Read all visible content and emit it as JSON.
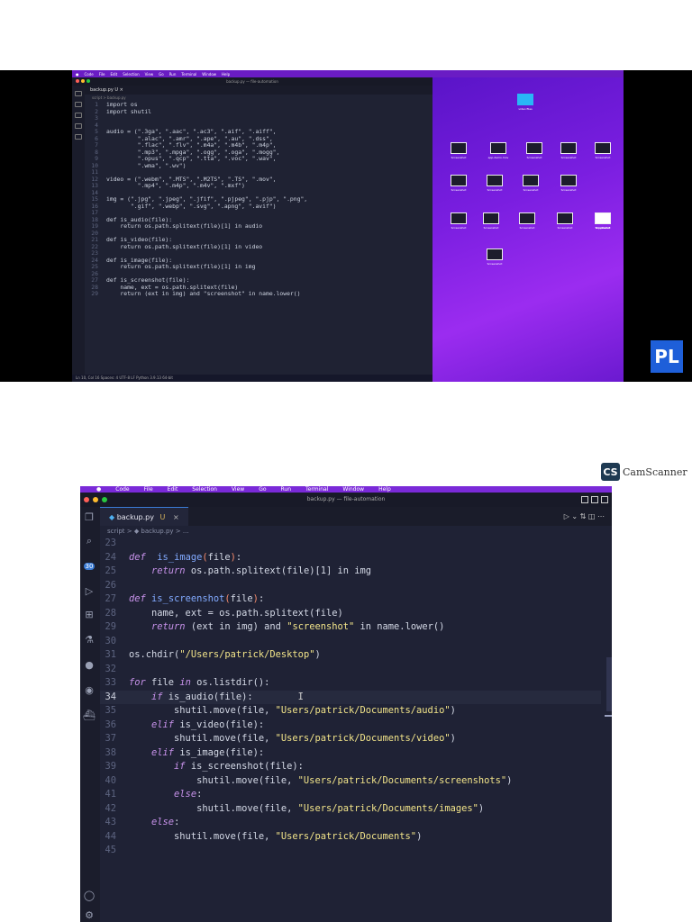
{
  "shot1": {
    "menubar": [
      "Code",
      "File",
      "Edit",
      "Selection",
      "View",
      "Go",
      "Run",
      "Terminal",
      "Window",
      "Help"
    ],
    "window_title": "backup.py — file-automation",
    "tab_label": "backup.py U ×",
    "breadcrumb": "script > backup.py",
    "code_lines": [
      {
        "n": "1",
        "t": "import os"
      },
      {
        "n": "2",
        "t": "import shutil"
      },
      {
        "n": "3",
        "t": ""
      },
      {
        "n": "4",
        "t": ""
      },
      {
        "n": "5",
        "t": "audio = (\".3ga\", \".aac\", \".ac3\", \".aif\", \".aiff\","
      },
      {
        "n": "6",
        "t": "         \".alac\", \".amr\", \".ape\", \".au\", \".dss\","
      },
      {
        "n": "7",
        "t": "         \".flac\", \".flv\", \".m4a\", \".m4b\", \".m4p\","
      },
      {
        "n": "8",
        "t": "         \".mp3\", \".mpga\", \".ogg\", \".oga\", \".mogg\","
      },
      {
        "n": "9",
        "t": "         \".opus\", \".qcp\", \".tta\", \".voc\", \".wav\","
      },
      {
        "n": "10",
        "t": "         \".wma\", \".wv\")"
      },
      {
        "n": "11",
        "t": ""
      },
      {
        "n": "12",
        "t": "video = (\".webm\", \".MTS\", \".M2TS\", \".TS\", \".mov\","
      },
      {
        "n": "13",
        "t": "         \".mp4\", \".m4p\", \".m4v\", \".mxf\")"
      },
      {
        "n": "14",
        "t": ""
      },
      {
        "n": "15",
        "t": "img = (\".jpg\", \".jpeg\", \".jfif\", \".pjpeg\", \".pjp\", \".png\","
      },
      {
        "n": "16",
        "t": "       \".gif\", \".webp\", \".svg\", \".apng\", \".avif\")"
      },
      {
        "n": "17",
        "t": ""
      },
      {
        "n": "18",
        "t": "def is_audio(file):"
      },
      {
        "n": "19",
        "t": "    return os.path.splitext(file)[1] in audio"
      },
      {
        "n": "20",
        "t": ""
      },
      {
        "n": "21",
        "t": "def is_video(file):"
      },
      {
        "n": "22",
        "t": "    return os.path.splitext(file)[1] in video"
      },
      {
        "n": "23",
        "t": ""
      },
      {
        "n": "24",
        "t": "def is_image(file):"
      },
      {
        "n": "25",
        "t": "    return os.path.splitext(file)[1] in img"
      },
      {
        "n": "26",
        "t": ""
      },
      {
        "n": "27",
        "t": "def is_screenshot(file):"
      },
      {
        "n": "28",
        "t": "    name, ext = os.path.splitext(file)"
      },
      {
        "n": "29",
        "t": "    return (ext in img) and \"screenshot\" in name.lower()"
      }
    ],
    "status_text": "Ln 10, Col 16   Spaces: 4   UTF-8   LF   Python   3.9.13 64-bit",
    "desktop_labels": [
      "video files",
      "Screenshot",
      "app-demo.mov",
      "Screenshot",
      "Screenshot",
      "Screenshot",
      "Screenshot",
      "Screenshot",
      "Screenshot",
      "Screenshot",
      "Screenshot",
      "Screenshot",
      "Screenshot",
      "Screenshot",
      "Screenshot",
      "Screenshot",
      "my_file.txt",
      "Screenshot"
    ],
    "logo_text": "PL"
  },
  "watermark": {
    "logo_text": "CS",
    "brand": "CamScanner"
  },
  "shot2": {
    "menubar": [
      "Code",
      "File",
      "Edit",
      "Selection",
      "View",
      "Go",
      "Run",
      "Terminal",
      "Window",
      "Help"
    ],
    "window_title": "backup.py — file-automation",
    "tab": {
      "name": "backup.py",
      "status": "U",
      "close": "×"
    },
    "tab_tools": "▷ ⌄  ⇅  ◫  ⋯",
    "breadcrumb": "script  >  ◆ backup.py  > ...",
    "activity_badge": "30",
    "lines": [
      {
        "n": "23",
        "parts": []
      },
      {
        "n": "24",
        "parts": [
          [
            "kw",
            "def"
          ],
          [
            "",
            "  "
          ],
          [
            "fn",
            "is_image"
          ],
          [
            "par",
            "("
          ],
          [
            "",
            "file"
          ],
          [
            "par",
            ")"
          ],
          [
            "",
            ":"
          ]
        ]
      },
      {
        "n": "25",
        "parts": [
          [
            "",
            "    "
          ],
          [
            "kw",
            "return"
          ],
          [
            "",
            " os.path.splitext(file)[1] in img"
          ]
        ]
      },
      {
        "n": "26",
        "parts": []
      },
      {
        "n": "27",
        "parts": [
          [
            "kw",
            "def"
          ],
          [
            "",
            " "
          ],
          [
            "fn",
            "is_screenshot"
          ],
          [
            "par",
            "("
          ],
          [
            "",
            "file"
          ],
          [
            "par",
            ")"
          ],
          [
            "",
            ":"
          ]
        ]
      },
      {
        "n": "28",
        "parts": [
          [
            "",
            "    name, ext = os.path.splitext(file)"
          ]
        ]
      },
      {
        "n": "29",
        "parts": [
          [
            "",
            "    "
          ],
          [
            "kw",
            "return"
          ],
          [
            "",
            " (ext in img) and "
          ],
          [
            "str",
            "\"screenshot\""
          ],
          [
            "",
            " in name.lower()"
          ]
        ]
      },
      {
        "n": "30",
        "parts": []
      },
      {
        "n": "31",
        "parts": [
          [
            "",
            "os.chdir("
          ],
          [
            "str",
            "\"/Users/patrick/Desktop\""
          ],
          [
            "",
            ")"
          ]
        ]
      },
      {
        "n": "32",
        "parts": []
      },
      {
        "n": "33",
        "parts": [
          [
            "kw",
            "for"
          ],
          [
            "",
            " file "
          ],
          [
            "kw",
            "in"
          ],
          [
            "",
            " os.listdir():"
          ]
        ]
      },
      {
        "n": "34",
        "cur": true,
        "parts": [
          [
            "",
            "    "
          ],
          [
            "kw",
            "if"
          ],
          [
            "",
            " is_audio(file):"
          ],
          [
            "cur-mark",
            "        I"
          ]
        ]
      },
      {
        "n": "35",
        "parts": [
          [
            "",
            "        shutil.move(file, "
          ],
          [
            "str",
            "\"Users/patrick/Documents/audio\""
          ],
          [
            "",
            ")"
          ]
        ]
      },
      {
        "n": "36",
        "parts": [
          [
            "",
            "    "
          ],
          [
            "kw",
            "elif"
          ],
          [
            "",
            " is_video(file):"
          ]
        ]
      },
      {
        "n": "37",
        "parts": [
          [
            "",
            "        shutil.move(file, "
          ],
          [
            "str",
            "\"Users/patrick/Documents/video\""
          ],
          [
            "",
            ")"
          ]
        ]
      },
      {
        "n": "38",
        "parts": [
          [
            "",
            "    "
          ],
          [
            "kw",
            "elif"
          ],
          [
            "",
            " is_image(file):"
          ]
        ]
      },
      {
        "n": "39",
        "parts": [
          [
            "",
            "        "
          ],
          [
            "kw",
            "if"
          ],
          [
            "",
            " is_screenshot(file):"
          ]
        ]
      },
      {
        "n": "40",
        "parts": [
          [
            "",
            "            shutil.move(file, "
          ],
          [
            "str",
            "\"Users/patrick/Documents/screenshots\""
          ],
          [
            "",
            ")"
          ]
        ]
      },
      {
        "n": "41",
        "parts": [
          [
            "",
            "        "
          ],
          [
            "kw",
            "else"
          ],
          [
            "",
            ":"
          ]
        ]
      },
      {
        "n": "42",
        "parts": [
          [
            "",
            "            shutil.move(file, "
          ],
          [
            "str",
            "\"Users/patrick/Documents/images\""
          ],
          [
            "",
            ")"
          ]
        ]
      },
      {
        "n": "43",
        "parts": [
          [
            "",
            "    "
          ],
          [
            "kw",
            "else"
          ],
          [
            "",
            ":"
          ]
        ]
      },
      {
        "n": "44",
        "parts": [
          [
            "",
            "        shutil.move(file, "
          ],
          [
            "str",
            "\"Users/patrick/Documents\""
          ],
          [
            "",
            ")"
          ]
        ]
      },
      {
        "n": "45",
        "parts": []
      }
    ],
    "colors": {
      "keyword": "#c792ea",
      "function": "#82aaff",
      "string": "#f3e58a",
      "paren": "#f78c6c",
      "menubar": "#7a2ad8",
      "editor_bg": "#1f2235"
    }
  }
}
